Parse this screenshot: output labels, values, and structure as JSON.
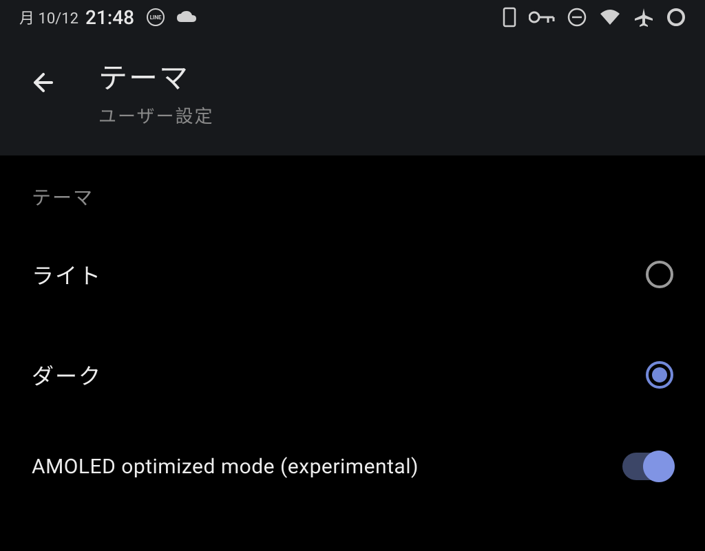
{
  "statusBar": {
    "date": "月 10/12",
    "time": "21:48"
  },
  "header": {
    "title": "テーマ",
    "subtitle": "ユーザー設定"
  },
  "section": {
    "label": "テーマ"
  },
  "options": {
    "light": {
      "label": "ライト",
      "selected": false
    },
    "dark": {
      "label": "ダーク",
      "selected": true
    },
    "amoled": {
      "label": "AMOLED optimized mode (experimental)",
      "enabled": true
    }
  }
}
